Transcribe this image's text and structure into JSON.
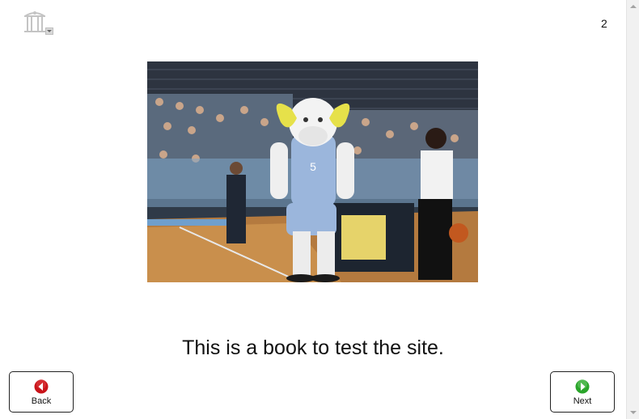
{
  "header": {
    "logo_icon": "old-well-logo-icon",
    "page_number": "2"
  },
  "main": {
    "image": {
      "description_icon": "basketball-mascot-photo"
    },
    "caption": "This is a book to test the site."
  },
  "navigation": {
    "back_label": "Back",
    "next_label": "Next",
    "back_icon": "left-arrow-icon",
    "next_icon": "right-arrow-icon",
    "back_color": "#c9141a",
    "next_color": "#2aa52a"
  }
}
